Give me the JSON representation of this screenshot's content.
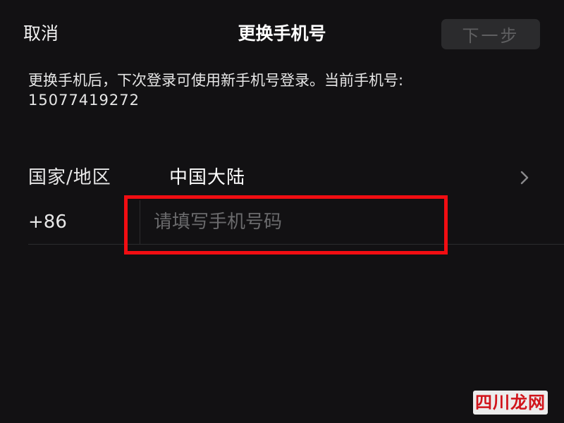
{
  "header": {
    "cancel_label": "取消",
    "title": "更换手机号",
    "next_label": "下一步",
    "next_enabled": false
  },
  "description": {
    "text": "更换手机后，下次登录可使用新手机号登录。当前手机号:",
    "current_phone": "15077419272"
  },
  "region_row": {
    "label": "国家/地区",
    "value": "中国大陆",
    "chevron_icon": "chevron-right-icon"
  },
  "phone_row": {
    "country_code": "+86",
    "input_value": "",
    "placeholder": "请填写手机号码"
  },
  "annotation": {
    "highlight_color": "#f10d12"
  },
  "watermark": {
    "text": "四川龙网"
  },
  "colors": {
    "background": "#121113",
    "disabled_button_bg": "#2b2b2d",
    "disabled_button_text": "#5f5f61",
    "placeholder_text": "#6a6a6c"
  }
}
